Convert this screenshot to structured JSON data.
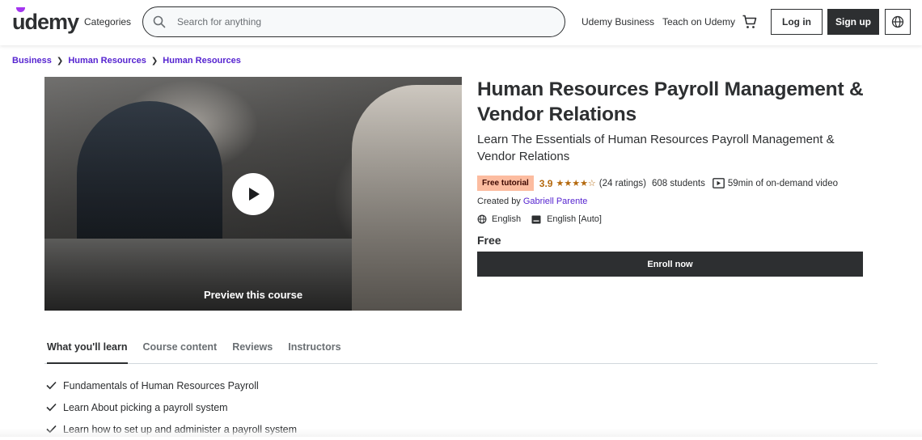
{
  "header": {
    "logo": "udemy",
    "categories_label": "Categories",
    "search_placeholder": "Search for anything",
    "business_label": "Udemy Business",
    "teach_label": "Teach on Udemy",
    "login_label": "Log in",
    "signup_label": "Sign up",
    "icons": [
      "search-icon",
      "cart-icon",
      "globe-icon"
    ]
  },
  "breadcrumb": [
    "Business",
    "Human Resources",
    "Human Resources"
  ],
  "preview": {
    "label": "Preview this course"
  },
  "course": {
    "title": "Human Resources Payroll Management & Vendor Relations",
    "subtitle": "Learn The Essentials of Human Resources Payroll Management & Vendor Relations",
    "badge": "Free tutorial",
    "rating": "3.9",
    "stars": "★★★★☆",
    "rating_value": 3.9,
    "ratings_count": "(24 ratings)",
    "students": "608 students",
    "video_length": "59min of on-demand video",
    "created_by_label": "Created by",
    "instructor": "Gabriell Parente",
    "language": "English",
    "captions": "English [Auto]",
    "price": "Free",
    "enroll_label": "Enroll now"
  },
  "tabs": [
    "What you'll learn",
    "Course content",
    "Reviews",
    "Instructors"
  ],
  "learn_items": [
    "Fundamentals of Human Resources Payroll",
    "Learn About picking a payroll system",
    "Learn how to set up and administer a payroll system"
  ],
  "colors": {
    "brand": "#a435f0",
    "link": "#5624d0",
    "dark": "#2d2f31",
    "rating": "#b4690e",
    "badge_bg": "#fcbca0"
  }
}
